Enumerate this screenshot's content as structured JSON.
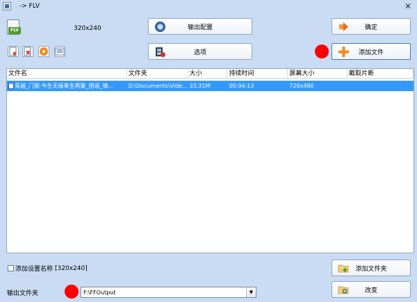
{
  "window": {
    "title": "-> FLV",
    "close_glyph": "✕"
  },
  "format": {
    "badge": "FLV",
    "resolution": "320x240"
  },
  "buttons": {
    "output_config": "输出配置",
    "options": "选项",
    "confirm": "确定",
    "add_file": "添加文件",
    "add_folder": "添加文件夹",
    "change": "改变"
  },
  "toolbar_icons": [
    "new-file-icon",
    "remove-file-icon",
    "play-icon",
    "media-info-icon"
  ],
  "table": {
    "columns": [
      "文件名",
      "文件夹",
      "大小",
      "持续时间",
      "屏幕大小",
      "截取片断"
    ],
    "rows": [
      {
        "name": "青越_门丽·今生无缘来生再聚_国语_情...",
        "folder": "D:\\Documents\\Vide...",
        "size": "33.31M",
        "duration": "00:04:13",
        "screen": "720x480",
        "clip": ""
      }
    ]
  },
  "settings": {
    "add_name_label": "添加设置名称",
    "add_name_value": "[320x240]",
    "checked": false
  },
  "output": {
    "label": "输出文件夹",
    "folder": "F:\\FFOutput",
    "dropdown_arrow": "▼"
  },
  "colors": {
    "background": "#c9dcf3",
    "selection": "#3399ff",
    "marker": "#ff0000"
  }
}
